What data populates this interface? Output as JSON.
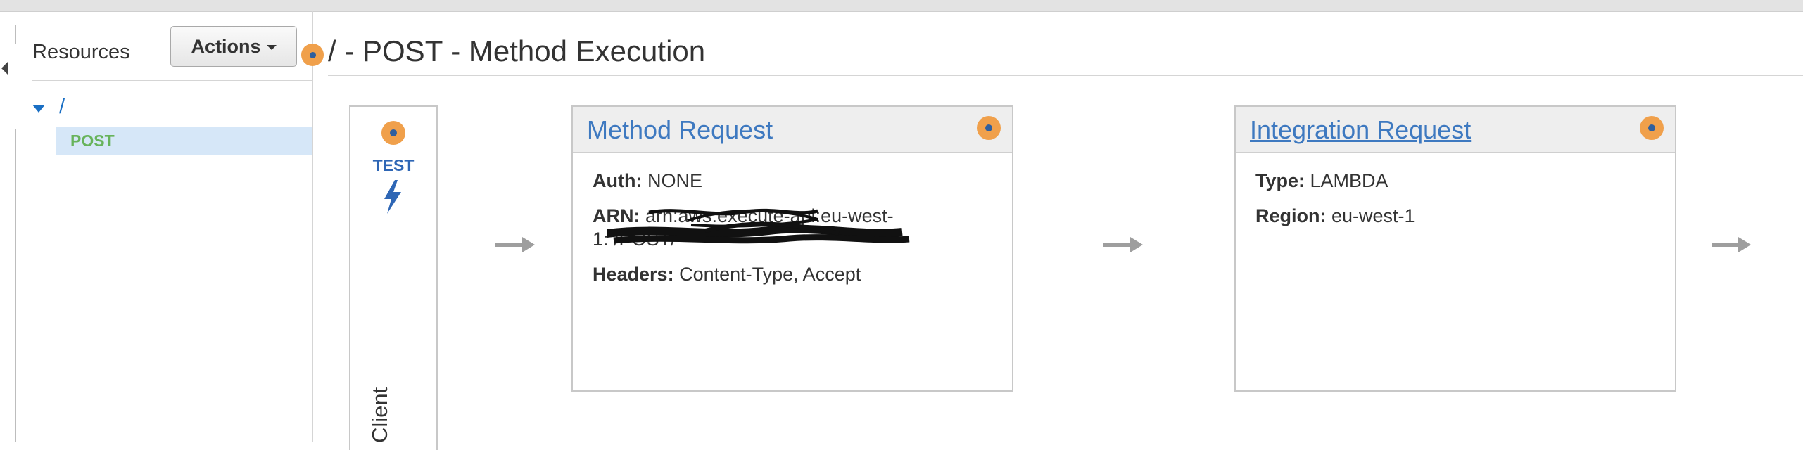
{
  "sidebar": {
    "title": "Resources",
    "actions_label": "Actions",
    "tree": {
      "root_label": "/",
      "child_label": "POST"
    }
  },
  "page": {
    "title": "/ - POST - Method Execution"
  },
  "client_panel": {
    "test_label": "TEST",
    "client_label": "Client"
  },
  "method_request": {
    "title": "Method Request",
    "rows": [
      {
        "label": "Auth:",
        "value": "NONE"
      },
      {
        "label": "ARN:",
        "value": "arn:aws:execute-api:eu-west-"
      },
      {
        "label": "",
        "value": "1:                /POST/"
      },
      {
        "label": "Headers:",
        "value": "Content-Type, Accept"
      }
    ]
  },
  "integration_request": {
    "title": "Integration Request",
    "rows": [
      {
        "label": "Type:",
        "value": "LAMBDA"
      },
      {
        "label": "Region:",
        "value": "eu-west-1"
      }
    ]
  },
  "icons": {
    "info": "info-circle-icon",
    "arrow": "arrow-right-icon",
    "bolt": "lightning-bolt-icon",
    "caret": "caret-down-icon",
    "collapse": "collapse-left-icon",
    "tree_toggle": "triangle-down-icon"
  },
  "colors": {
    "accent_blue": "#3e79c0",
    "link_blue": "#1a6fc4",
    "post_green": "#67b35b",
    "info_orange": "#f0a04b",
    "selection_bg": "#d6e7f8"
  }
}
